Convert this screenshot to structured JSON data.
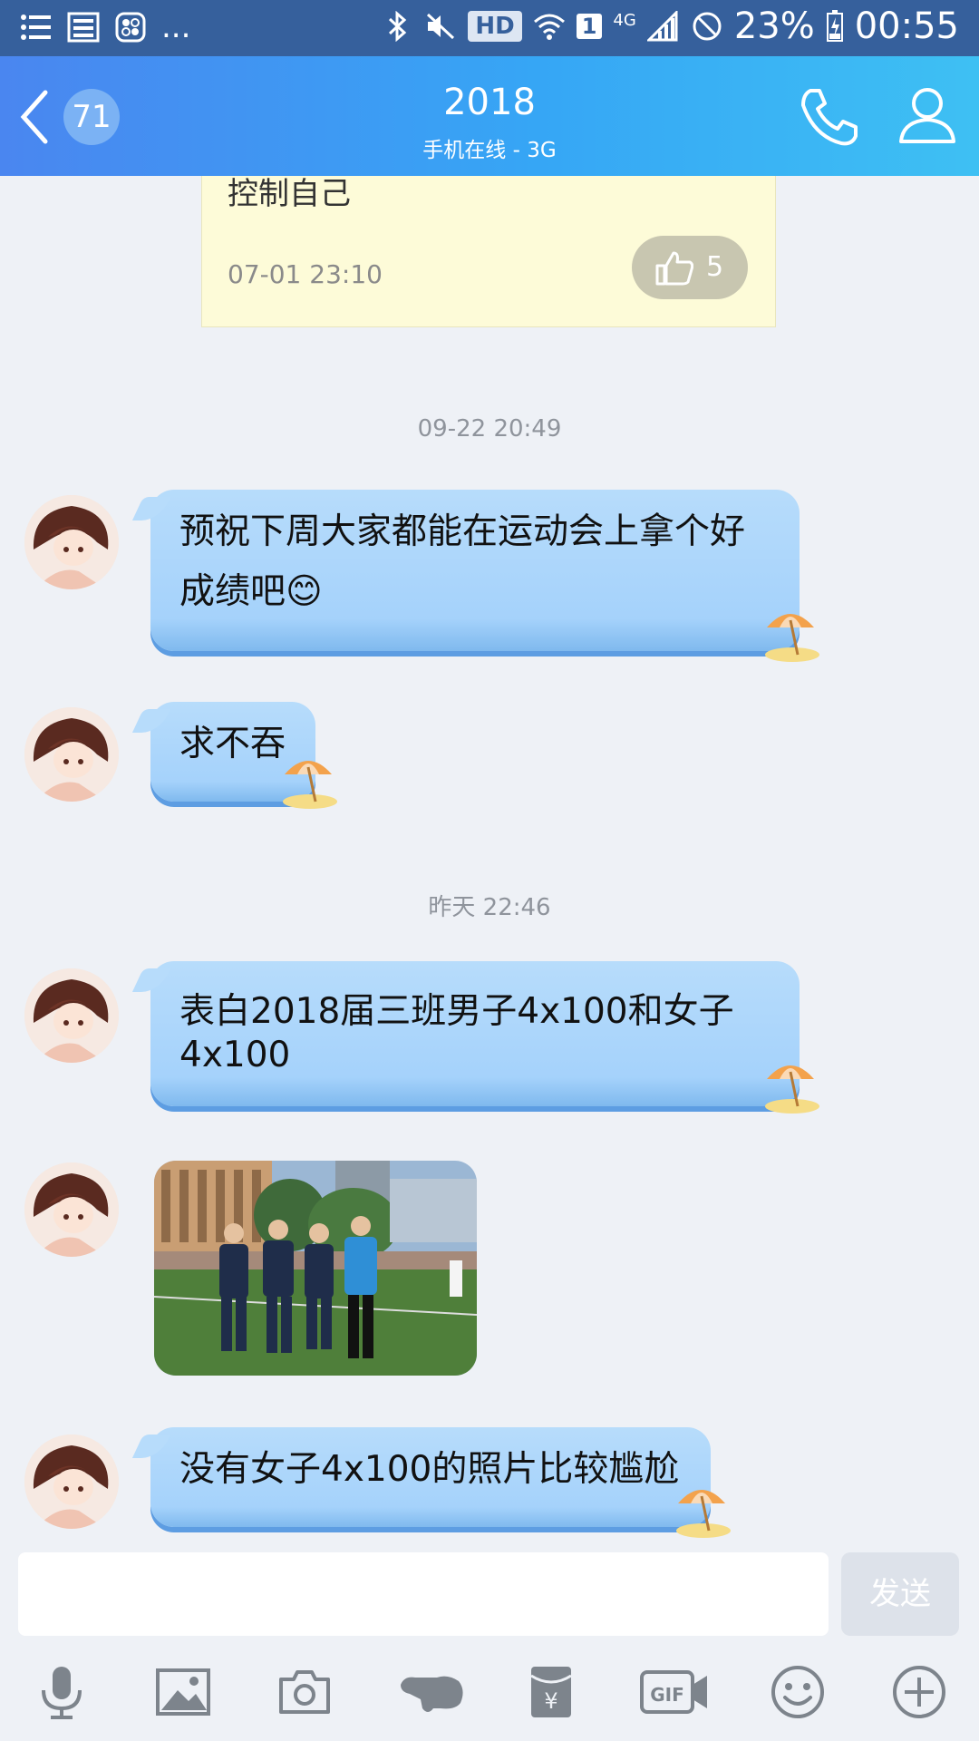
{
  "status_bar": {
    "ellipsis": "...",
    "hd": "HD",
    "network": "4G",
    "sim": "1",
    "battery": "23%",
    "time": "00:55"
  },
  "header": {
    "back_count": "71",
    "title": "2018",
    "subtitle": "手机在线 - 3G"
  },
  "chat": {
    "note": {
      "text": "控制自己",
      "time": "07-01 23:10",
      "likes": "5"
    },
    "timestamps": [
      "09-22 20:49",
      "昨天 22:46"
    ],
    "messages": [
      "预祝下周大家都能在运动会上拿个好成绩吧😊",
      "求不吞",
      "表白2018届三班男子4x100和女子4x100",
      "没有女子4x100的照片比较尴尬"
    ]
  },
  "input": {
    "placeholder": "",
    "send_label": "发送"
  },
  "toolbar": [
    "mic-icon",
    "image-icon",
    "camera-icon",
    "gesture-icon",
    "red-packet-icon",
    "gif-icon",
    "emoji-icon",
    "plus-icon"
  ]
}
